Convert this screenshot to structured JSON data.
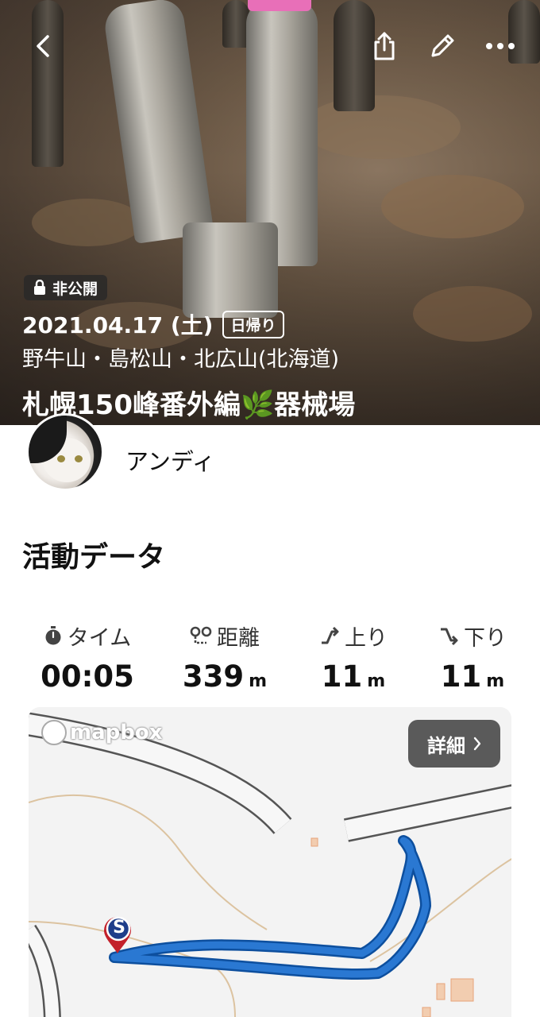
{
  "hero": {
    "privacy": "非公開",
    "date": "2021.04.17 (土)",
    "trip_type": "日帰り",
    "mountains": "野牛山・島松山・北広山(北海道)",
    "title": "札幌150峰番外編🌿器械場"
  },
  "user": {
    "name": "アンディ"
  },
  "section": {
    "activity_title": "活動データ"
  },
  "stats": [
    {
      "label": "タイム",
      "value": "00:05",
      "unit": "",
      "icon": "stopwatch-icon"
    },
    {
      "label": "距離",
      "value": "339",
      "unit": "m",
      "icon": "route-distance-icon"
    },
    {
      "label": "上り",
      "value": "11",
      "unit": "m",
      "icon": "ascent-icon"
    },
    {
      "label": "下り",
      "value": "11",
      "unit": "m",
      "icon": "descent-icon"
    }
  ],
  "map": {
    "attribution": "mapbox",
    "detail_label": "詳細",
    "start_marker": "S",
    "route_color": "#2a78d2"
  },
  "colors": {
    "accent_pink_tape": "#e86fb8",
    "route": "#2a78d2",
    "detail_button": "#5a5a5a"
  }
}
